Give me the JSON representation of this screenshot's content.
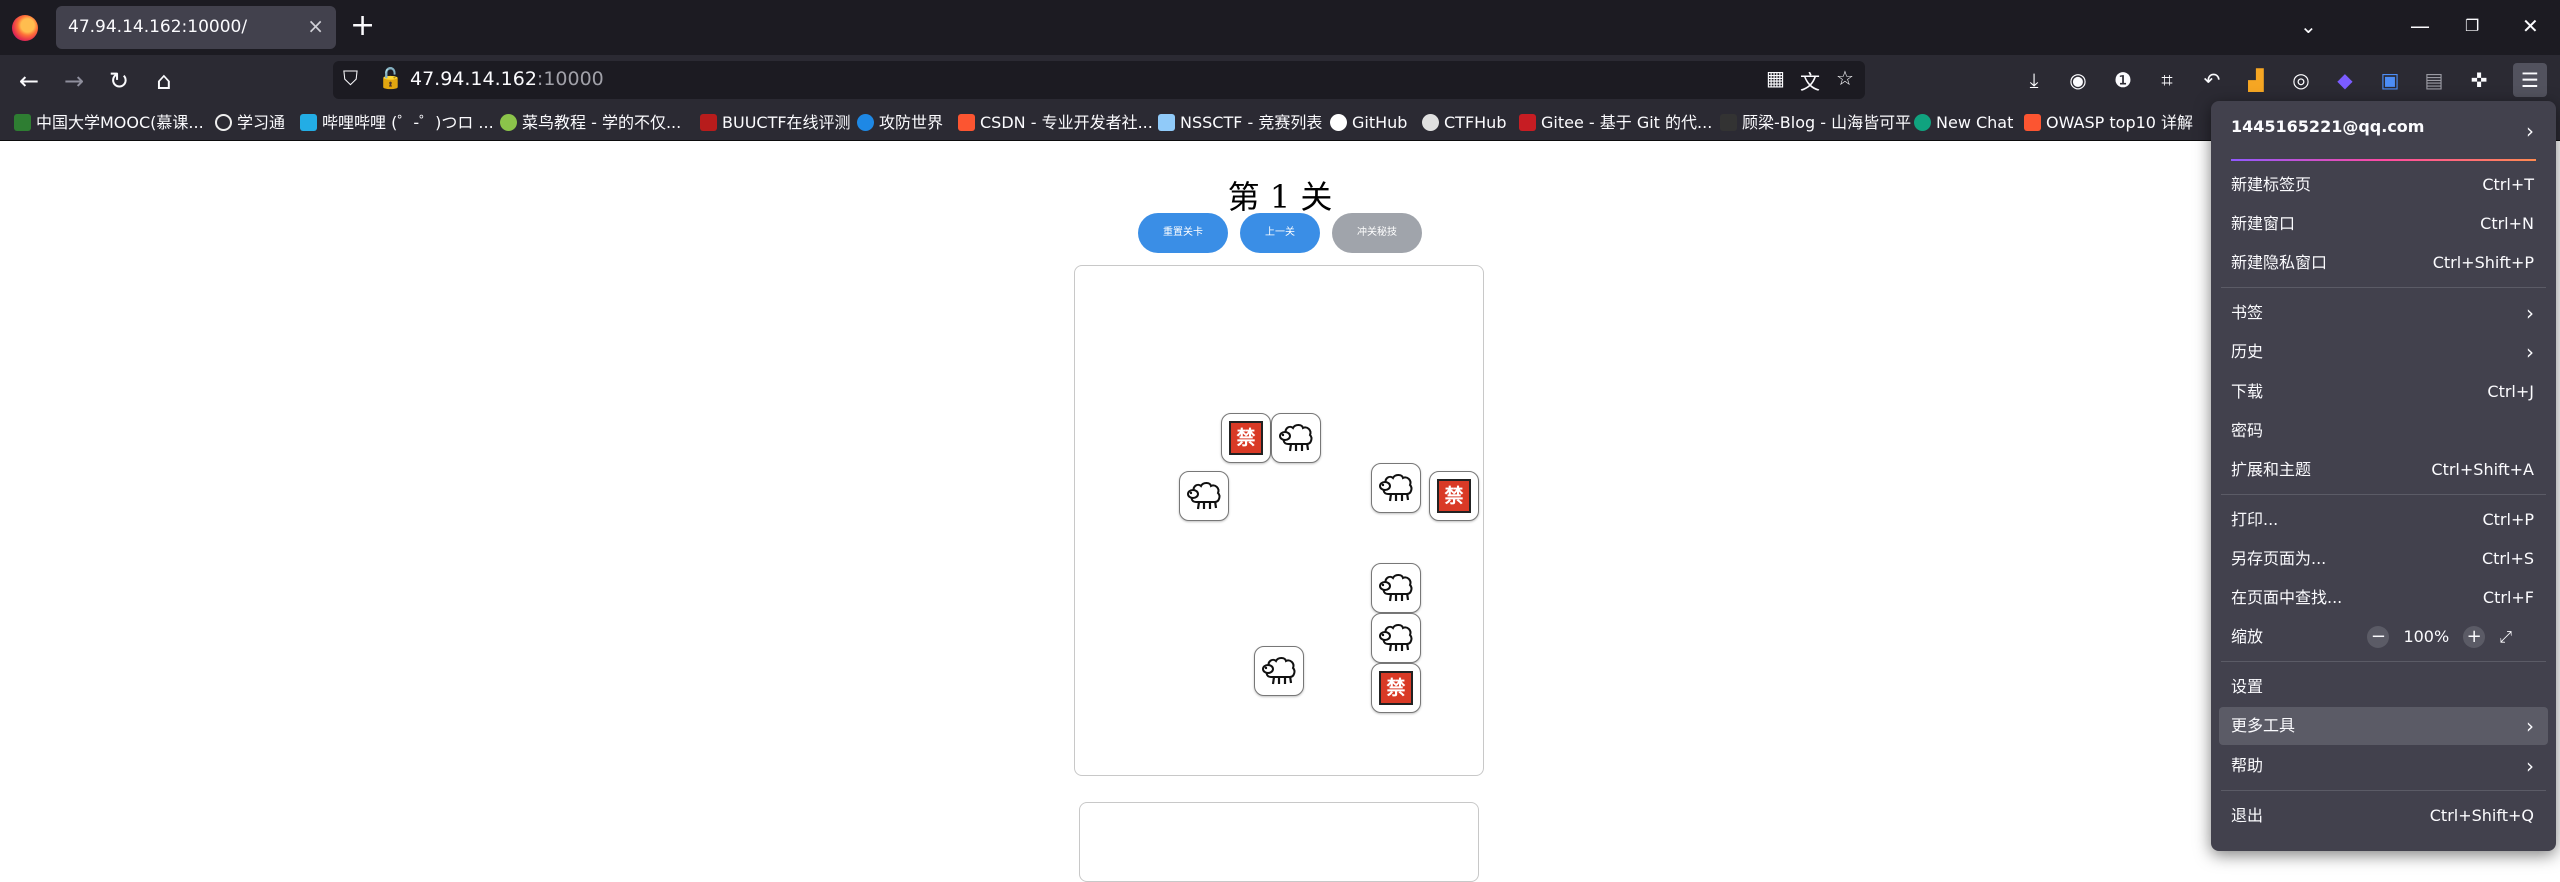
{
  "browser": {
    "tab_title": "47.94.14.162:10000/",
    "tab_close": "×",
    "new_tab": "+",
    "url_host": "47.94.14.162",
    "url_port": ":10000",
    "bookmarks": [
      {
        "label": "中国大学MOOC(慕课...",
        "color": "#2e7d32"
      },
      {
        "label": "学习通",
        "color": "#f0f0f0"
      },
      {
        "label": "哔哩哔哩 (゜-゜)つロ ...",
        "color": "#23ade5"
      },
      {
        "label": "菜鸟教程 - 学的不仅...",
        "color": "#8bc34a"
      },
      {
        "label": "BUUCTF在线评测",
        "color": "#b71c1c"
      },
      {
        "label": "攻防世界",
        "color": "#1e88e5"
      },
      {
        "label": "CSDN - 专业开发者社...",
        "color": "#fc5531"
      },
      {
        "label": "NSSCTF - 竞赛列表",
        "color": "#90caf9"
      },
      {
        "label": "GitHub",
        "color": "#ffffff"
      },
      {
        "label": "CTFHub",
        "color": "#e0e0e0"
      },
      {
        "label": "Gitee - 基于 Git 的代...",
        "color": "#c71d23"
      },
      {
        "label": "顾梁-Blog - 山海皆可平",
        "color": "#333333"
      },
      {
        "label": "New Chat",
        "color": "#10a37f"
      },
      {
        "label": "OWASP top10 详解",
        "color": "#fc5531"
      }
    ]
  },
  "page": {
    "level_title": "第 1 关",
    "buttons": {
      "reset": "重置关卡",
      "prev": "上一关",
      "cheat": "冲关秘技"
    },
    "tiles": [
      {
        "kind": "ban",
        "label": "禁"
      },
      {
        "kind": "sheep",
        "icon": "sheep-icon"
      },
      {
        "kind": "sheep",
        "icon": "sheep-icon"
      },
      {
        "kind": "sheep",
        "icon": "sheep-icon"
      },
      {
        "kind": "ban",
        "label": "禁"
      },
      {
        "kind": "sheep",
        "icon": "sheep-icon"
      },
      {
        "kind": "sheep",
        "icon": "sheep-icon"
      },
      {
        "kind": "sheep",
        "icon": "sheep-icon"
      },
      {
        "kind": "ban",
        "label": "禁"
      }
    ]
  },
  "menu": {
    "account": "1445165221@qq.com",
    "items": [
      {
        "label": "新建标签页",
        "shortcut": "Ctrl+T"
      },
      {
        "label": "新建窗口",
        "shortcut": "Ctrl+N"
      },
      {
        "label": "新建隐私窗口",
        "shortcut": "Ctrl+Shift+P"
      },
      {
        "label": "书签",
        "shortcut": ""
      },
      {
        "label": "历史",
        "shortcut": ""
      },
      {
        "label": "下载",
        "shortcut": "Ctrl+J"
      },
      {
        "label": "密码",
        "shortcut": ""
      },
      {
        "label": "扩展和主题",
        "shortcut": "Ctrl+Shift+A"
      },
      {
        "label": "打印...",
        "shortcut": "Ctrl+P"
      },
      {
        "label": "另存页面为...",
        "shortcut": "Ctrl+S"
      },
      {
        "label": "在页面中查找...",
        "shortcut": "Ctrl+F"
      },
      {
        "label": "缩放",
        "shortcut": ""
      },
      {
        "label": "设置",
        "shortcut": ""
      },
      {
        "label": "更多工具",
        "shortcut": ""
      },
      {
        "label": "帮助",
        "shortcut": ""
      },
      {
        "label": "退出",
        "shortcut": "Ctrl+Shift+Q"
      }
    ],
    "zoom": {
      "minus": "−",
      "value": "100%",
      "plus": "+"
    }
  },
  "colors": {
    "button_blue": "#3a8ee6",
    "button_gray": "#a0a4ab",
    "ban_red": "#d93a26",
    "menu_bg": "#42414d"
  }
}
